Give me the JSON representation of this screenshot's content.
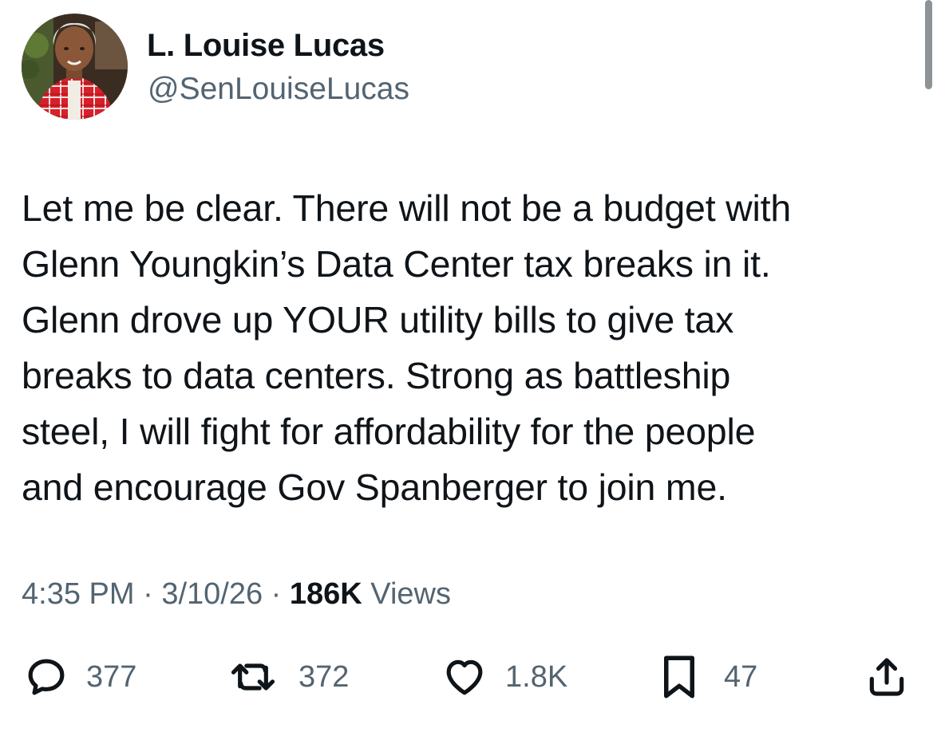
{
  "author": {
    "name": "L. Louise Lucas",
    "handle": "@SenLouiseLucas",
    "avatar_icon": "profile-photo"
  },
  "post": {
    "lines": [
      "Let me be clear. There will not be a budget with",
      "Glenn Youngkin’s Data Center tax breaks in it.",
      "Glenn drove up YOUR utility bills to give tax",
      "breaks to data centers. Strong as battleship",
      "steel, I will fight for affordability for the people",
      "and encourage Gov Spanberger to join me."
    ]
  },
  "meta": {
    "time": "4:35 PM",
    "separator": "·",
    "date": "3/10/26",
    "views_count": "186K",
    "views_label": "Views"
  },
  "actions": {
    "replies": "377",
    "reposts": "372",
    "likes": "1.8K",
    "bookmarks": "47"
  },
  "colors": {
    "text": "#0f1419",
    "secondary": "#536471",
    "background": "#ffffff"
  }
}
